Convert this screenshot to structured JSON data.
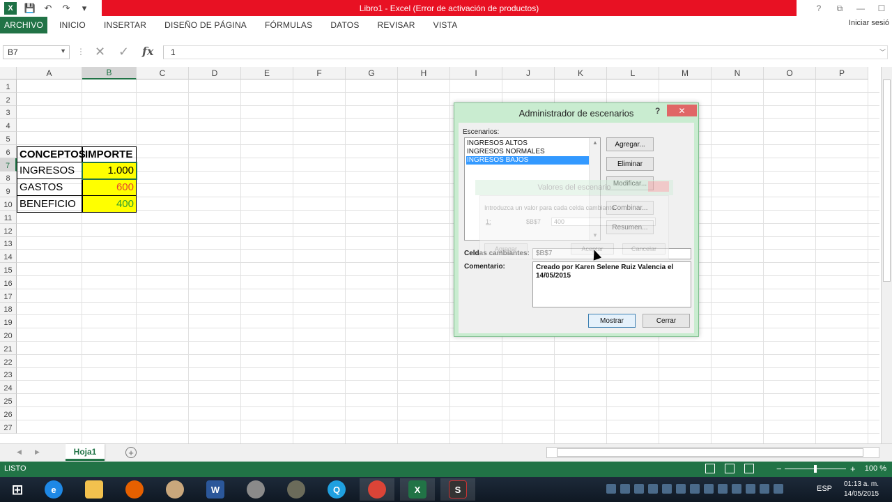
{
  "window": {
    "title": "Libro1 -  Excel (Error de activación de productos)",
    "controls": [
      "?",
      "⧉",
      "—",
      "☐"
    ]
  },
  "ribbon": {
    "tabs": [
      "ARCHIVO",
      "INICIO",
      "INSERTAR",
      "DISEÑO DE PÁGINA",
      "FÓRMULAS",
      "DATOS",
      "REVISAR",
      "VISTA"
    ],
    "signin": "Iniciar sesió"
  },
  "formula_bar": {
    "name_box": "B7",
    "fx_label": "fx",
    "value": "1"
  },
  "grid": {
    "columns": [
      "A",
      "B",
      "C",
      "D",
      "E",
      "F",
      "G",
      "H",
      "I",
      "J",
      "K",
      "L",
      "M",
      "N",
      "O",
      "P"
    ],
    "rows": [
      "1",
      "2",
      "3",
      "4",
      "5",
      "6",
      "7",
      "8",
      "9",
      "10",
      "11",
      "12",
      "13",
      "14",
      "15",
      "16",
      "17",
      "18",
      "19",
      "20",
      "21",
      "22",
      "23",
      "24",
      "25",
      "26",
      "27"
    ],
    "selected_cell": "B7",
    "table": {
      "headers": [
        "CONCEPTOS",
        "IMPORTE"
      ],
      "rows": [
        {
          "concept": "INGRESOS",
          "value": "1.000",
          "color": "#000000"
        },
        {
          "concept": "GASTOS",
          "value": "600",
          "color": "#e8452e"
        },
        {
          "concept": "BENEFICIO",
          "value": "400",
          "color": "#2f9e2f"
        }
      ]
    }
  },
  "sheets": {
    "tabs": [
      "Hoja1"
    ],
    "add_label": "+"
  },
  "status_bar": {
    "text": "LISTO",
    "zoom": "100 %"
  },
  "dialog": {
    "title": "Administrador de escenarios",
    "help": "?",
    "close": "✕",
    "scenarios_label": "Escenarios:",
    "scenarios": [
      "INGRESOS ALTOS",
      "INGRESOS NORMALES",
      "INGRESOS BAJOS"
    ],
    "selected_scenario": 2,
    "buttons": {
      "add": "Agregar...",
      "delete": "Eliminar",
      "edit": "Modificar...",
      "merge": "Combinar...",
      "summary": "Resumen..."
    },
    "changing_cells_label": "Celdas cambiantes:",
    "changing_cells": "$B$7",
    "comment_label": "Comentario:",
    "comment": "Creado por Karen Selene Ruiz Valencia el 14/05/2015",
    "show": "Mostrar",
    "close_button": "Cerrar"
  },
  "ghost_dialog": {
    "title": "Valores del escenario",
    "prompt": "Introduzca un valor para cada celda cambiante.",
    "row_index": "1:",
    "cell_ref": "$B$7",
    "cell_value": "400",
    "add": "Agregar",
    "ok": "Aceptar",
    "cancel": "Cancelar"
  },
  "taskbar": {
    "language": "ESP",
    "time": "01:13 a. m.",
    "date": "14/05/2015"
  }
}
